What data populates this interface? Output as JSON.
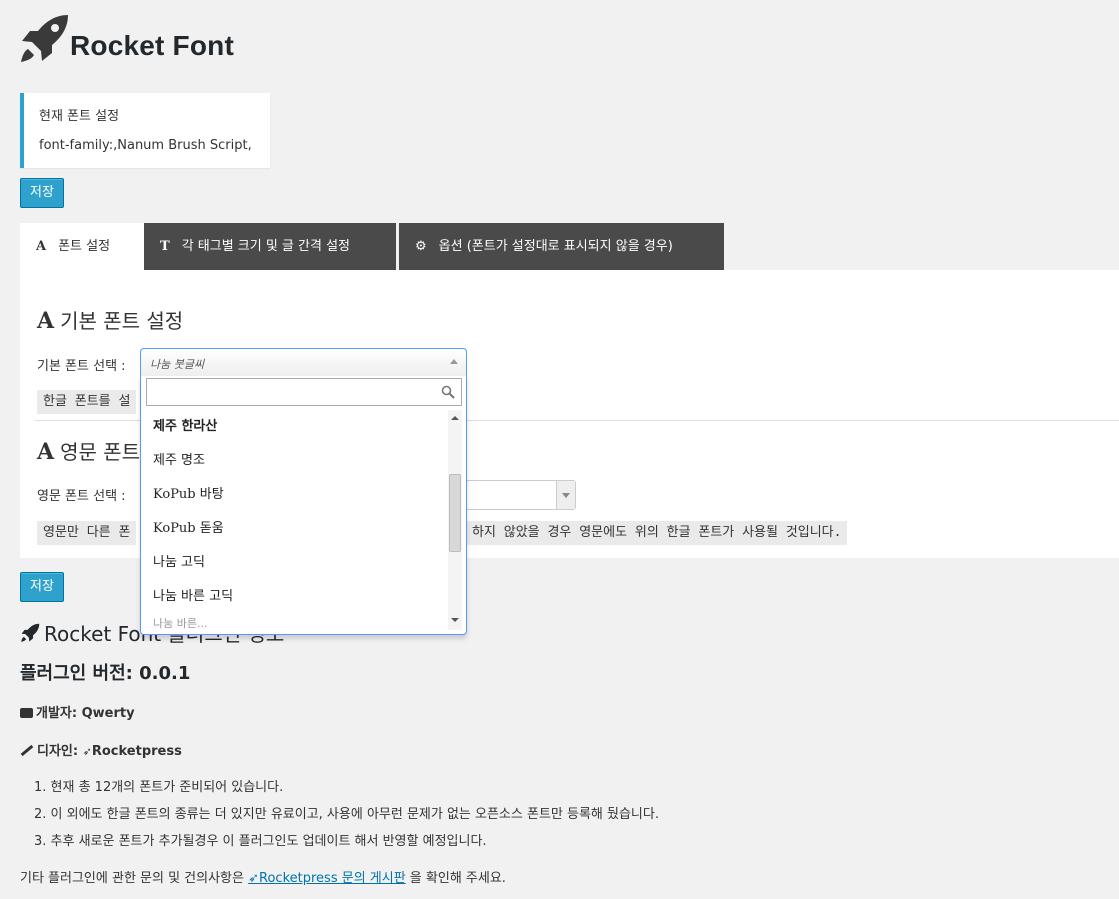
{
  "app": {
    "title": "Rocket Font"
  },
  "current": {
    "title": "현재 폰트 설정",
    "value": "font-family:,Nanum Brush Script,"
  },
  "buttons": {
    "save": "저장"
  },
  "tabs": [
    {
      "icon": "A",
      "label": "폰트 설정"
    },
    {
      "icon": "T",
      "label": "각 태그별 크기 및 글 간격 설정"
    },
    {
      "icon": "⚙",
      "label": "옵션 (폰트가 설정대로 표시되지 않을 경우)"
    }
  ],
  "base": {
    "title": "기본 폰트 설정",
    "label": "기본 폰트 선택 :",
    "selected": "나눔 붓글씨",
    "hint": "한글 폰트를 설"
  },
  "english": {
    "title": "영문 폰트",
    "label": "영문 폰트 선택 :",
    "hint_left": "영문만 다른 폰",
    "hint_right": "하지 않았을 경우 영문에도 위의 한글 폰트가 사용될 것입니다."
  },
  "dropdown": {
    "items": [
      "제주 한라산",
      "제주 명조",
      "KoPub 바탕",
      "KoPub 돋움",
      "나눔 고딕",
      "나눔 바른 고딕",
      "나눔 바른..."
    ]
  },
  "plugin": {
    "title_a": "Rocket Font",
    "title_b": " 플러그인 정보",
    "version": "플러그인 버전: 0.0.1",
    "developer_label": "개발자:",
    "developer": "Qwerty",
    "designer_label": "디자인:",
    "designer": "Rocketpress",
    "notes": [
      "1. 현재 총 12개의 폰트가 준비되어 있습니다.",
      "2. 이 외에도 한글 폰트의 종류는 더 있지만 유료이고, 사용에 아무런 문제가 없는 오픈소스 폰트만 등록해 뒀습니다.",
      "3. 추후 새로운 폰트가 추가될경우 이 플러그인도 업데이트 해서 반영할 예정입니다."
    ],
    "footer_before": "기타 플러그인에 관한 문의 및 건의사항은 ",
    "footer_link": "Rocketpress 문의 게시판",
    "footer_after": " 을 확인해 주세요."
  }
}
